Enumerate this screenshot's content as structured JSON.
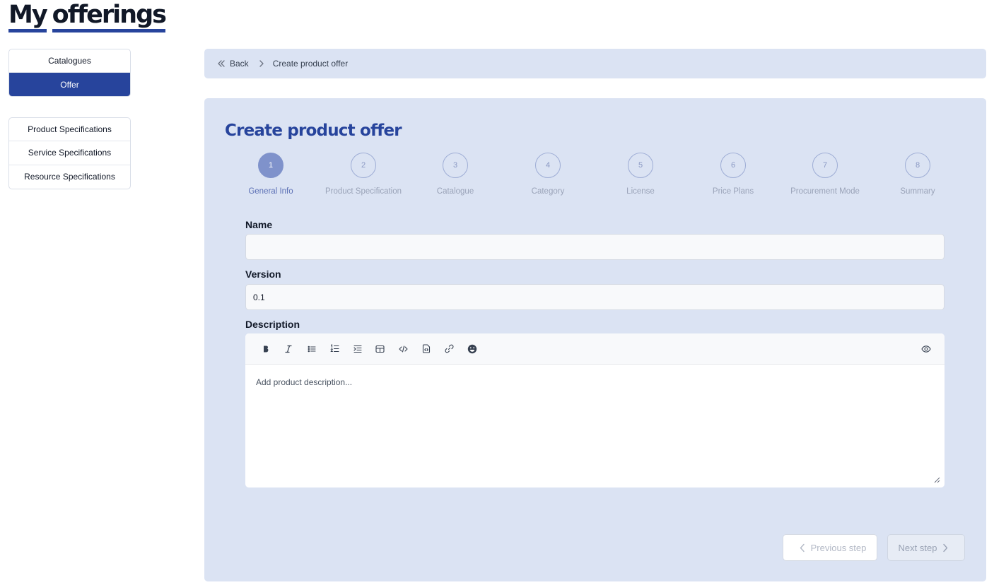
{
  "page": {
    "title_word1": "My",
    "title_word2": "offerings"
  },
  "sidebar": {
    "group1": [
      {
        "label": "Catalogues",
        "active": false
      },
      {
        "label": "Offer",
        "active": true
      }
    ],
    "group2": [
      {
        "label": "Product Specifications"
      },
      {
        "label": "Service Specifications"
      },
      {
        "label": "Resource Specifications"
      }
    ]
  },
  "breadcrumb": {
    "back_label": "Back",
    "current": "Create product offer"
  },
  "form": {
    "title": "Create product offer",
    "steps": [
      {
        "number": "1",
        "label": "General Info",
        "active": true
      },
      {
        "number": "2",
        "label": "Product Specification"
      },
      {
        "number": "3",
        "label": "Catalogue"
      },
      {
        "number": "4",
        "label": "Category"
      },
      {
        "number": "5",
        "label": "License"
      },
      {
        "number": "6",
        "label": "Price Plans"
      },
      {
        "number": "7",
        "label": "Procurement Mode"
      },
      {
        "number": "8",
        "label": "Summary"
      }
    ],
    "name": {
      "label": "Name",
      "value": "",
      "placeholder": ""
    },
    "version": {
      "label": "Version",
      "value": "0.1"
    },
    "description": {
      "label": "Description",
      "placeholder": "Add product description...",
      "toolbar": [
        "bold-icon",
        "italic-icon",
        "bullet-list-icon",
        "numbered-list-icon",
        "indent-icon",
        "table-icon",
        "code-icon",
        "code-block-icon",
        "link-icon",
        "emoji-icon"
      ],
      "preview_icon": "eye-icon"
    },
    "buttons": {
      "previous": "Previous step",
      "next": "Next step"
    }
  },
  "colors": {
    "accent": "#27449c",
    "panel": "#dbe3f3",
    "step_active": "#7f92cb"
  }
}
